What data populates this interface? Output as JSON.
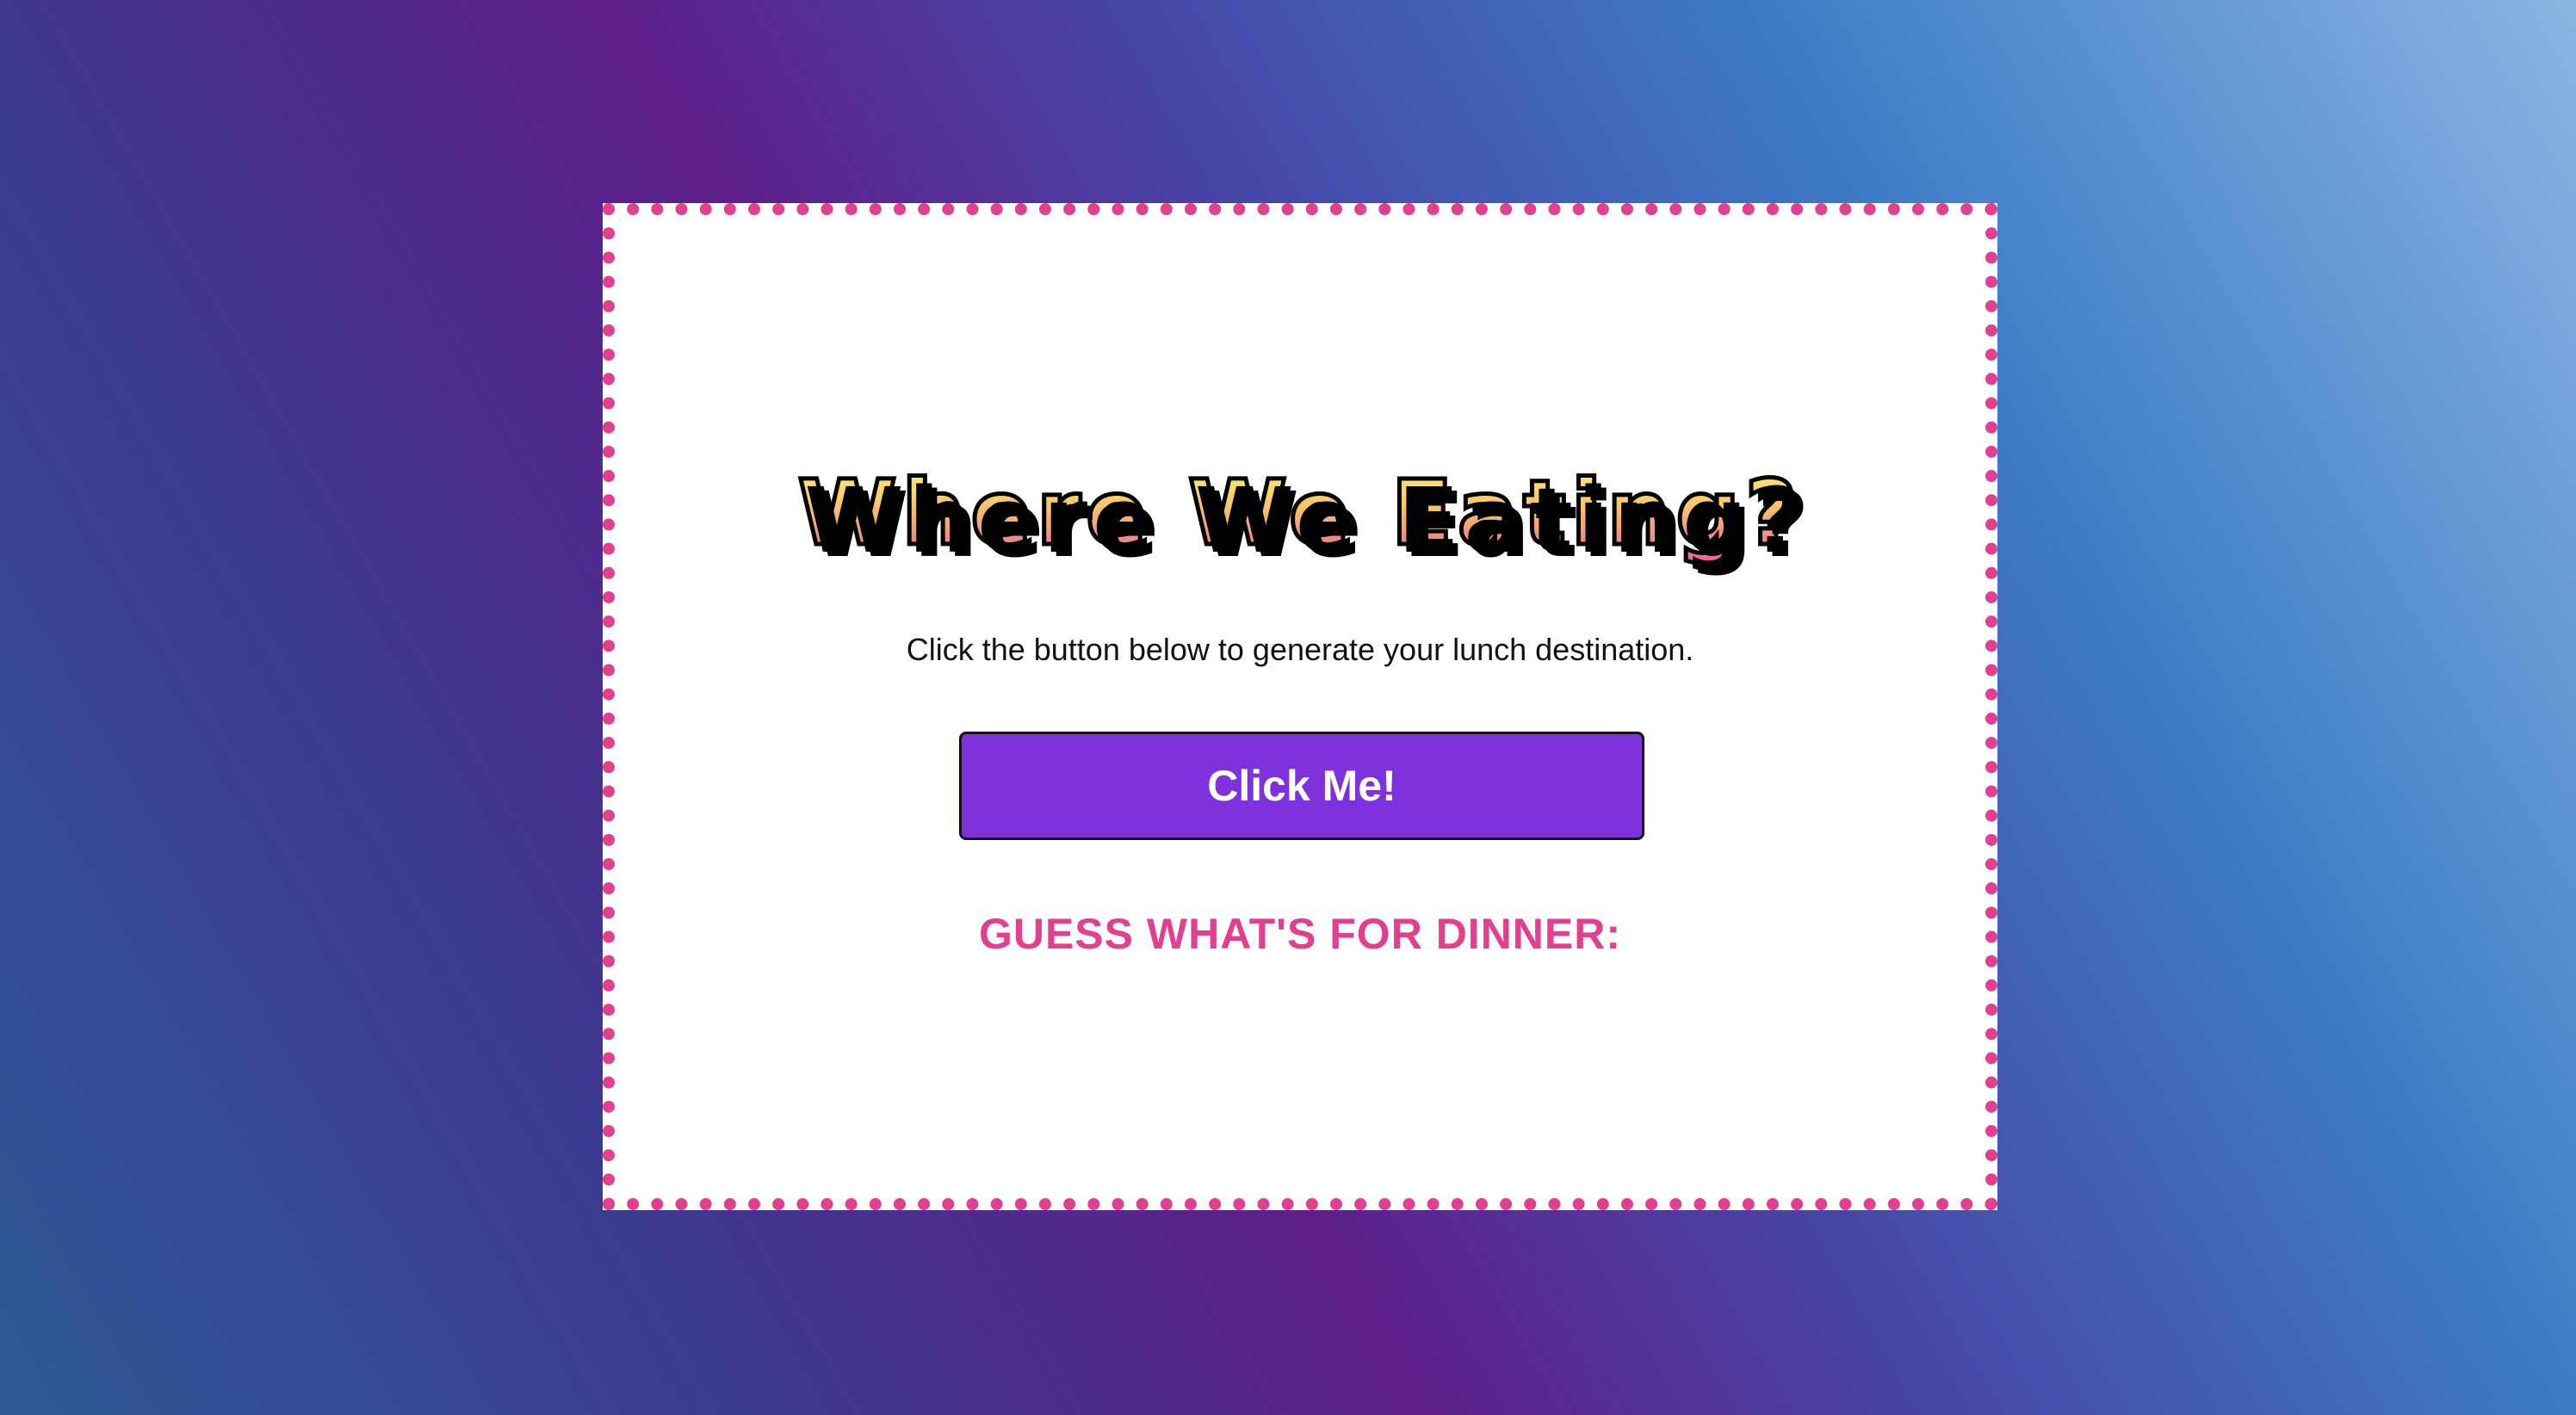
{
  "app": {
    "title": "Where We Eating?",
    "instructions": "Click the button below to generate your lunch destination.",
    "button_label": "Click Me!",
    "result_label": "GUESS WHAT'S FOR DINNER:"
  },
  "colors": {
    "border_dots": "#e23f8f",
    "button_bg": "#7e32dc",
    "result_text": "#e23f8f",
    "title_gradient_top": "#fff37a",
    "title_gradient_bottom": "#ea5ba2"
  }
}
